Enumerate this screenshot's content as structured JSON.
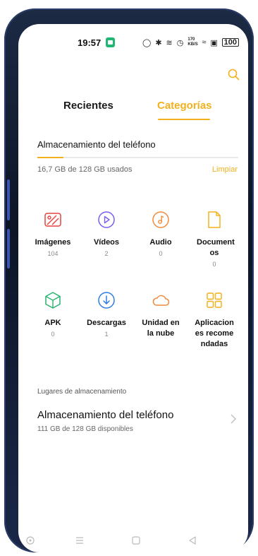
{
  "status": {
    "time": "19:57",
    "speed": "170 KB/S",
    "battery": "100"
  },
  "tabs": [
    {
      "label": "Recientes"
    },
    {
      "label": "Categorías"
    }
  ],
  "storage": {
    "title": "Almacenamiento del teléfono",
    "used_text": "16,7 GB de 128 GB usados",
    "used_fraction": 0.13,
    "clear_label": "Limpiar"
  },
  "categories": [
    {
      "label": "Imágenes",
      "count": "104",
      "icon": "images-icon",
      "color": "#e8423e"
    },
    {
      "label": "Vídeos",
      "count": "2",
      "icon": "video-icon",
      "color": "#7a5cf0"
    },
    {
      "label": "Audio",
      "count": "0",
      "icon": "audio-icon",
      "color": "#f08a3c"
    },
    {
      "label": "Document os",
      "count": "0",
      "icon": "document-icon",
      "color": "#f2b01c"
    },
    {
      "label": "APK",
      "count": "0",
      "icon": "apk-icon",
      "color": "#29b46e"
    },
    {
      "label": "Descargas",
      "count": "1",
      "icon": "download-icon",
      "color": "#2f7de1"
    },
    {
      "label": "Unidad en la nube",
      "count": "",
      "icon": "cloud-icon",
      "color": "#f08a3c"
    },
    {
      "label": "Aplicacion es recome ndadas",
      "count": "",
      "icon": "apps-icon",
      "color": "#f2b01c"
    }
  ],
  "places": {
    "title": "Lugares de almacenamiento",
    "item": {
      "name": "Almacenamiento del teléfono",
      "sub": "111 GB de 128 GB disponibles"
    }
  },
  "nav": {
    "icons": [
      "circle-icon",
      "menu-icon",
      "home-icon",
      "back-icon"
    ]
  }
}
